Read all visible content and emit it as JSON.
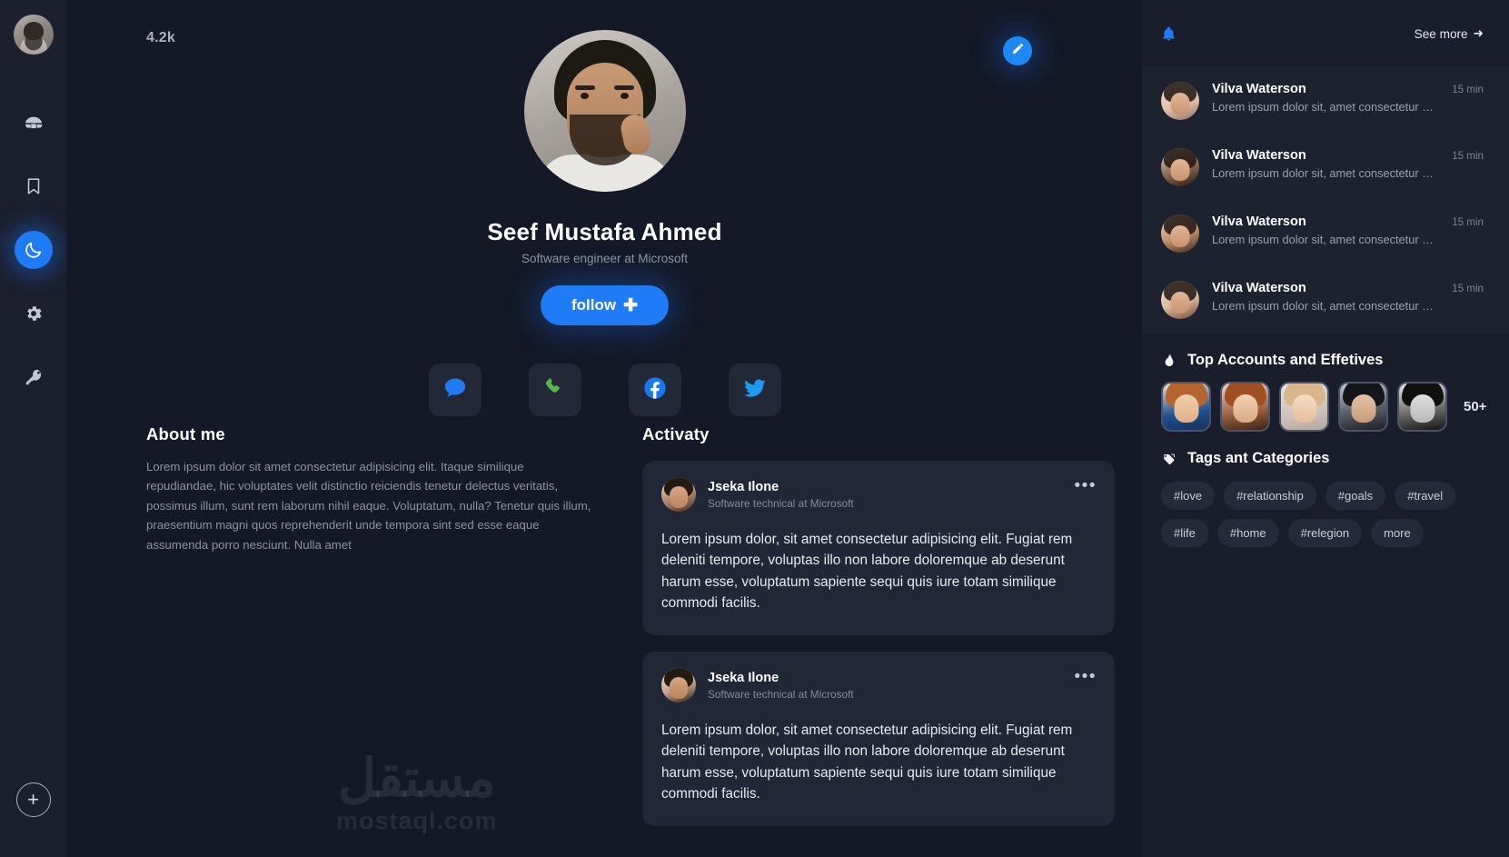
{
  "sidebar": {
    "avatar_name": "user-avatar",
    "items": [
      {
        "name": "sidebar-item-igloo",
        "icon": "igloo-icon",
        "active": false
      },
      {
        "name": "sidebar-item-bookmark",
        "icon": "bookmark-icon",
        "active": false
      },
      {
        "name": "sidebar-item-darkmode",
        "icon": "moon-icon",
        "active": true
      },
      {
        "name": "sidebar-item-settings",
        "icon": "gear-icon",
        "active": false
      },
      {
        "name": "sidebar-item-key",
        "icon": "key-icon",
        "active": false
      }
    ],
    "add_label": "+"
  },
  "header": {
    "count": "4.2k",
    "edit_icon": "pencil-icon"
  },
  "profile": {
    "name": "Seef Mustafa Ahmed",
    "title": "Software engineer at Microsoft",
    "follow_label": "follow",
    "follow_plus": "✚",
    "socials": [
      {
        "name": "social-message",
        "icon": "message-icon",
        "color": "#1f7bf6"
      },
      {
        "name": "social-phone",
        "icon": "phone-icon",
        "color": "#4caf50"
      },
      {
        "name": "social-facebook",
        "icon": "facebook-icon",
        "color": "#1877f2"
      },
      {
        "name": "social-twitter",
        "icon": "twitter-icon",
        "color": "#1d9bf0"
      }
    ]
  },
  "about": {
    "heading": "About me",
    "text": "Lorem ipsum dolor sit amet consectetur adipisicing elit. Itaque similique repudiandae, hic voluptates velit distinctio reiciendis tenetur delectus veritatis, possimus illum, sunt rem laborum nihil eaque. Voluptatum, nulla? Tenetur quis illum, praesentium magni quos reprehenderit unde tempora sint sed esse eaque assumenda porro nesciunt. Nulla amet"
  },
  "activity": {
    "heading": "Activaty",
    "menu_glyph": "•••",
    "posts": [
      {
        "author": "Jseka Ilone",
        "role": "Software technical at Microsoft",
        "body": "Lorem ipsum dolor, sit amet consectetur adipisicing elit. Fugiat rem deleniti tempore, voluptas illo non labore doloremque ab deserunt harum esse, voluptatum sapiente sequi quis iure totam similique commodi facilis."
      },
      {
        "author": "Jseka Ilone",
        "role": "Software technical at Microsoft",
        "body": "Lorem ipsum dolor, sit amet consectetur adipisicing elit. Fugiat rem deleniti tempore, voluptas illo non labore doloremque ab deserunt harum esse, voluptatum sapiente sequi quis iure totam similique commodi facilis."
      }
    ]
  },
  "watermark": {
    "arabic": "مستقل",
    "latin": "mostaql.com"
  },
  "right_panel": {
    "bell_icon": "bell-icon",
    "see_more": "See more",
    "see_more_arrow": "➜",
    "notifications": [
      {
        "name": "Vilva Waterson",
        "text": "Lorem ipsum dolor sit, amet consectetur adipisicing",
        "time": "15 min"
      },
      {
        "name": "Vilva Waterson",
        "text": "Lorem ipsum dolor sit, amet consectetur adipisicing",
        "time": "15 min"
      },
      {
        "name": "Vilva Waterson",
        "text": "Lorem ipsum dolor sit, amet consectetur adipisicing",
        "time": "15 min"
      },
      {
        "name": "Vilva Waterson",
        "text": "Lorem ipsum dolor sit, amet consectetur adipisicing",
        "time": "15 min"
      }
    ],
    "top_accounts": {
      "title": "Top Accounts and Effetives",
      "icon": "flame-icon",
      "more_label": "50+"
    },
    "tags_section": {
      "title": "Tags ant Categories",
      "icon": "tag-icon",
      "tags": [
        "#love",
        "#relationship",
        "#goals",
        "#travel",
        "#life",
        "#home",
        "#relegion",
        "more"
      ]
    }
  },
  "colors": {
    "accent": "#1f7bf6",
    "bg": "#141827",
    "panel": "#1a1e2c",
    "card": "#212736"
  }
}
